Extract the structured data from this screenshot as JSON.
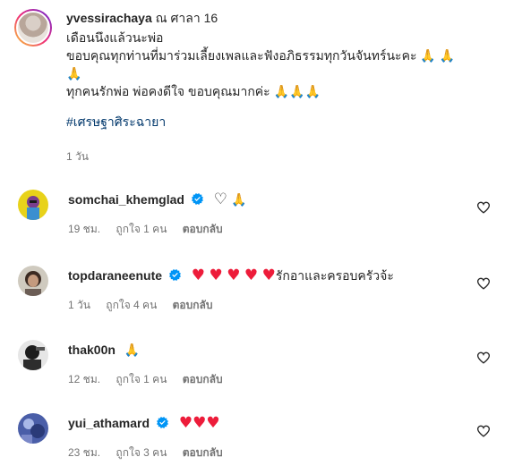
{
  "caption": {
    "username": "yvessirachaya",
    "location": "ณ ศาลา 16",
    "lines": [
      "เดือนนึงแล้วนะพ่อ",
      "ขอบคุณทุกท่านที่มาร่วมเลี้ยงเพลและฟังอภิธรรมทุกวันจันทร์นะคะ 🙏 🙏",
      "🙏",
      "ทุกคนรักพ่อ พ่อคงดีใจ ขอบคุณมากค่ะ 🙏🙏🙏"
    ],
    "hashtag": "#เศรษฐาศิระฉายา",
    "time": "1 วัน"
  },
  "comments": [
    {
      "username": "somchai_khemglad",
      "verified": true,
      "text": "♡ 🙏",
      "time": "19 ชม.",
      "likes": "ถูกใจ 1 คน",
      "reply": "ตอบกลับ"
    },
    {
      "username": "topdaraneenute",
      "verified": true,
      "text": "♥ ♥ ♥ ♥ ♥รักอาและครอบครัวจ้ะ",
      "time": "1 วัน",
      "likes": "ถูกใจ 4 คน",
      "reply": "ตอบกลับ"
    },
    {
      "username": "thak00n",
      "verified": false,
      "text": "🙏",
      "time": "12 ชม.",
      "likes": "ถูกใจ 1 คน",
      "reply": "ตอบกลับ"
    },
    {
      "username": "yui_athamard",
      "verified": true,
      "text": "♥♥♥",
      "time": "23 ชม.",
      "likes": "ถูกใจ 3 คน",
      "reply": "ตอบกลับ"
    }
  ],
  "icons": {
    "verified": "verified-badge-icon",
    "like": "heart-outline-icon"
  },
  "colors": {
    "verified": "#0095f6",
    "heart": "#ed1c3a",
    "meta": "#737373",
    "hashtag": "#00376b"
  }
}
